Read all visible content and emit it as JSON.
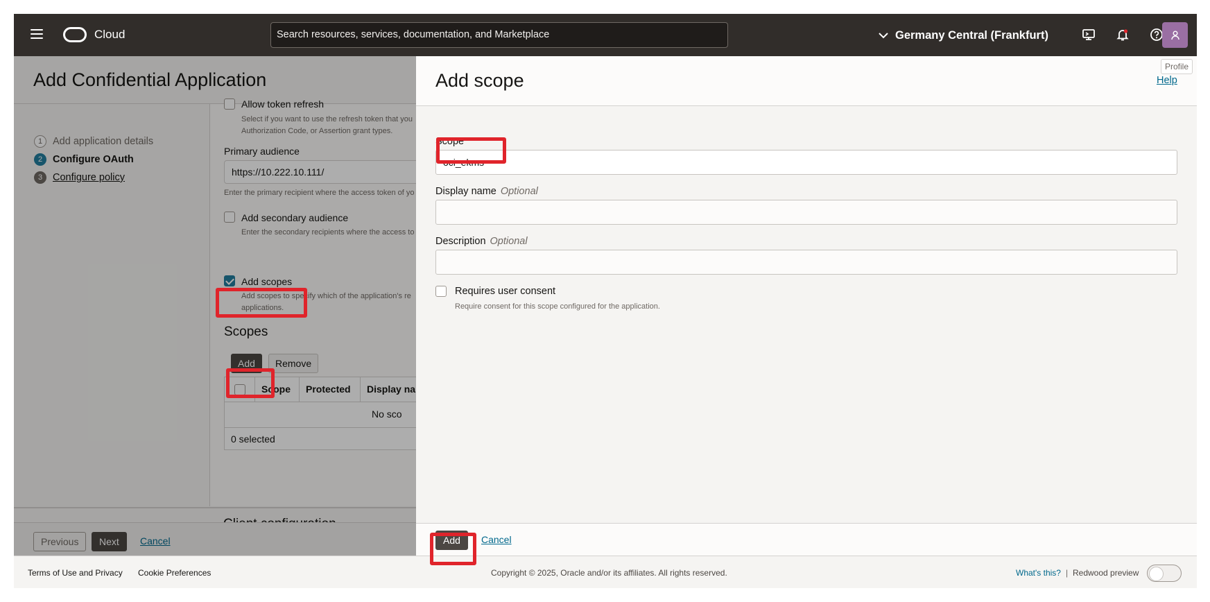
{
  "header": {
    "brand": "Cloud",
    "search_placeholder": "Search resources, services, documentation, and Marketplace",
    "region": "Germany Central (Frankfurt)",
    "tooltip": "Profile"
  },
  "page": {
    "title": "Add Confidential Application",
    "steps": [
      {
        "num": "1",
        "label": "Add application details"
      },
      {
        "num": "2",
        "label": "Configure OAuth"
      },
      {
        "num": "3",
        "label": "Configure policy"
      }
    ],
    "form": {
      "refresh_label": "Allow token refresh",
      "refresh_help_1": "Select if you want to use the refresh token that you",
      "refresh_help_2": "Authorization Code, or Assertion grant types.",
      "primary_audience_label": "Primary audience",
      "primary_audience_value": "https://10.222.10.111/",
      "primary_audience_help": "Enter the primary recipient where the access token of yo",
      "secondary_label": "Add secondary audience",
      "secondary_help": "Enter the secondary recipients where the access to",
      "add_scopes_label": "Add scopes",
      "add_scopes_help_1": "Add scopes to specify which of the application's re",
      "add_scopes_help_2": "applications.",
      "scopes_heading": "Scopes",
      "add_button": "Add",
      "remove_button": "Remove",
      "table_headers": [
        "Scope",
        "Protected",
        "Display na"
      ],
      "table_empty": "No sco",
      "table_selected": "0 selected",
      "next_section": "Client configuration"
    },
    "footer": {
      "previous": "Previous",
      "next": "Next",
      "cancel": "Cancel"
    }
  },
  "drawer": {
    "title": "Add scope",
    "help": "Help",
    "scope_label": "Scope",
    "scope_value": "oci_ekms",
    "display_name_label": "Display name",
    "display_name_optional": "Optional",
    "description_label": "Description",
    "description_optional": "Optional",
    "consent_label": "Requires user consent",
    "consent_help": "Require consent for this scope configured for the application.",
    "add_button": "Add",
    "cancel_button": "Cancel"
  },
  "pagefooter": {
    "terms": "Terms of Use and Privacy",
    "cookies": "Cookie Preferences",
    "copyright": "Copyright © 2025, Oracle and/or its affiliates. All rights reserved.",
    "whats_this": "What's this?",
    "separator": "|",
    "redwood": "Redwood preview"
  },
  "colors": {
    "header_bg": "#312d2a",
    "accent": "#227e9e",
    "highlight": "#e0242b",
    "link": "#00688c",
    "avatar": "#9a6fa3"
  }
}
